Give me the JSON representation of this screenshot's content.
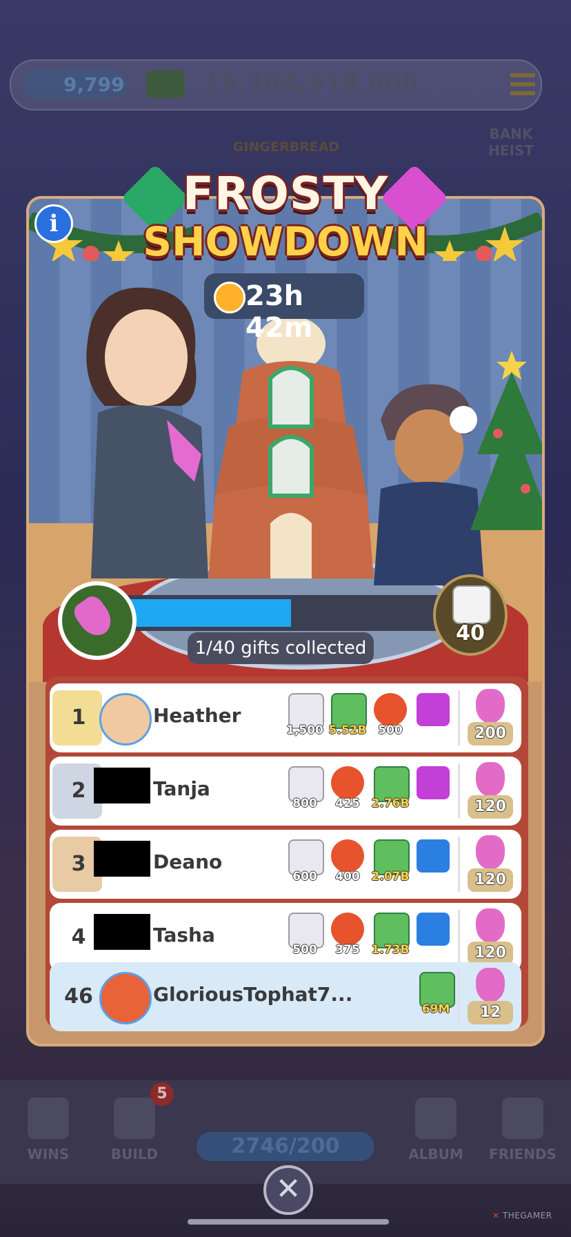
{
  "background": {
    "gems": "9,799",
    "money": "19,304,918,800",
    "bank_heist_label": "BANK HEIST",
    "gingerbread_label": "GINGERBREAD",
    "nav": [
      {
        "label": "WINS",
        "icon": "wins-icon"
      },
      {
        "label": "BUILD",
        "icon": "build-icon",
        "badge": "5"
      },
      {
        "label": "ALBUM",
        "icon": "album-icon"
      },
      {
        "label": "FRIENDS",
        "icon": "friends-icon"
      }
    ],
    "progress_pill": "2746/200",
    "watermark": "THEGAMER"
  },
  "event": {
    "title_line1": "FROSTY",
    "title_line2": "SHOWDOWN",
    "timer": "23h 42m",
    "gifts_text": "1/40 gifts collected",
    "progress_fraction": 0.025,
    "dice_count": "40",
    "colors": {
      "accent_blue": "#1ea7f2",
      "title_gold": "#ffd24a",
      "board_red": "#b44838"
    }
  },
  "leaderboard": [
    {
      "rank": "1",
      "name": "Heather",
      "censored": false,
      "rewards": [
        {
          "type": "dice",
          "label": "1,500"
        },
        {
          "type": "cash",
          "label": "5.52B"
        },
        {
          "type": "boost",
          "label": "500"
        },
        {
          "type": "sticker-pink",
          "label": ""
        }
      ],
      "points": "200"
    },
    {
      "rank": "2",
      "name": "Tanja",
      "censored": true,
      "rewards": [
        {
          "type": "dice",
          "label": "800"
        },
        {
          "type": "boost",
          "label": "425"
        },
        {
          "type": "cash",
          "label": "2.76B"
        },
        {
          "type": "sticker-pink",
          "label": ""
        }
      ],
      "points": "120"
    },
    {
      "rank": "3",
      "name": "Deano",
      "censored": true,
      "rewards": [
        {
          "type": "dice",
          "label": "600"
        },
        {
          "type": "boost",
          "label": "400"
        },
        {
          "type": "cash",
          "label": "2.07B"
        },
        {
          "type": "sticker-blue",
          "label": ""
        }
      ],
      "points": "120"
    },
    {
      "rank": "4",
      "name": "Tasha",
      "censored": true,
      "rewards": [
        {
          "type": "dice",
          "label": "500"
        },
        {
          "type": "boost",
          "label": "375"
        },
        {
          "type": "cash",
          "label": "1.73B"
        },
        {
          "type": "sticker-blue",
          "label": ""
        }
      ],
      "points": "120"
    },
    {
      "rank": "46",
      "name": "GloriousTophat7...",
      "censored": false,
      "me": true,
      "rewards": [
        {
          "type": "cash",
          "label": "69M"
        }
      ],
      "points": "12"
    }
  ]
}
